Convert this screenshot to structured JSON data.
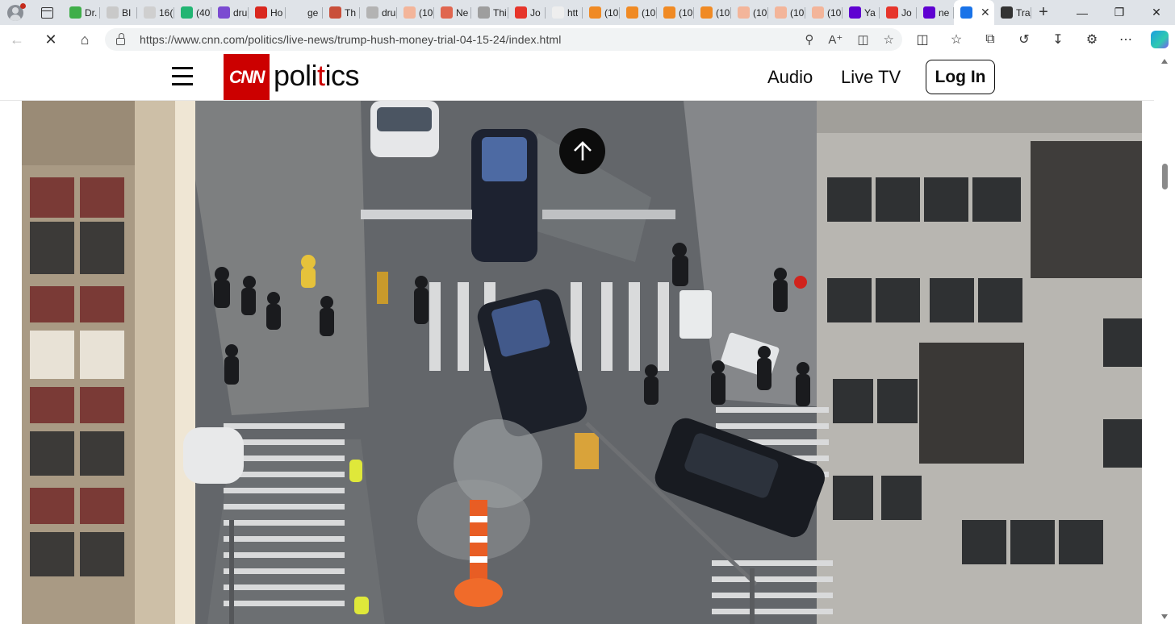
{
  "browser": {
    "tabs": [
      {
        "title": "Dr.",
        "favicon_color": "#3fae49"
      },
      {
        "title": "BI",
        "favicon_color": "#c9c9c9"
      },
      {
        "title": "16(",
        "favicon_color": "#cfcfcf"
      },
      {
        "title": "(40",
        "favicon_color": "#22b573"
      },
      {
        "title": "dru",
        "favicon_color": "#7b4bd1"
      },
      {
        "title": "Ho",
        "favicon_color": "#d9271e"
      },
      {
        "title": "ge",
        "favicon_color": "#dfe3e8"
      },
      {
        "title": "Th",
        "favicon_color": "#c94f3a"
      },
      {
        "title": "dru",
        "favicon_color": "#b3b3b3"
      },
      {
        "title": "(10",
        "favicon_color": "#f3b59a"
      },
      {
        "title": "Ne",
        "favicon_color": "#e0664f"
      },
      {
        "title": "Thi",
        "favicon_color": "#9e9e9e"
      },
      {
        "title": "Jo",
        "favicon_color": "#e6352b"
      },
      {
        "title": "htt",
        "favicon_color": "#eeeeee"
      },
      {
        "title": "(10",
        "favicon_color": "#f08a24"
      },
      {
        "title": "(10",
        "favicon_color": "#f08a24"
      },
      {
        "title": "(10",
        "favicon_color": "#f08a24"
      },
      {
        "title": "(10",
        "favicon_color": "#f08a24"
      },
      {
        "title": "(10",
        "favicon_color": "#f3b59a"
      },
      {
        "title": "(10",
        "favicon_color": "#f3b59a"
      },
      {
        "title": "(10",
        "favicon_color": "#f3b59a"
      },
      {
        "title": "Ya",
        "favicon_color": "#5f01d1"
      },
      {
        "title": "Jo",
        "favicon_color": "#e6352b"
      },
      {
        "title": "ne",
        "favicon_color": "#5f01d1"
      },
      {
        "title": "",
        "favicon_color": "#1a73e8",
        "active": true
      },
      {
        "title": "Tra",
        "favicon_color": "#333333"
      }
    ],
    "url": "https://www.cnn.com/politics/live-news/trump-hush-money-trial-04-15-24/index.html"
  },
  "header": {
    "logo_text": "CNN",
    "section_prefix": "poli",
    "section_accent": "t",
    "section_suffix": "ics",
    "nav": {
      "audio": "Audio",
      "live_tv": "Live TV"
    },
    "login": "Log In"
  },
  "colors": {
    "brand_red": "#cc0000",
    "text": "#0c0c0c"
  }
}
